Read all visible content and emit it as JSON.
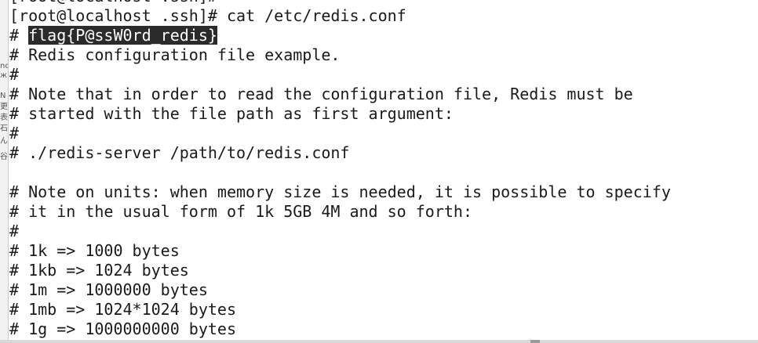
{
  "terminal": {
    "left_strip_glyphs": [
      "nc",
      "ж",
      "N",
      "更",
      "表",
      "石",
      "ん",
      "谷"
    ],
    "lines": [
      {
        "prefix": "[root@localhost .ssh]#",
        "highlight": "",
        "suffix": ""
      },
      {
        "prefix": "[root@localhost .ssh]# cat /etc/redis.conf",
        "highlight": "",
        "suffix": ""
      },
      {
        "prefix": "# ",
        "highlight": "flag{P@ssW0rd_redis}",
        "suffix": ""
      },
      {
        "prefix": "# Redis configuration file example.",
        "highlight": "",
        "suffix": ""
      },
      {
        "prefix": "#",
        "highlight": "",
        "suffix": ""
      },
      {
        "prefix": "# Note that in order to read the configuration file, Redis must be",
        "highlight": "",
        "suffix": ""
      },
      {
        "prefix": "# started with the file path as first argument:",
        "highlight": "",
        "suffix": ""
      },
      {
        "prefix": "#",
        "highlight": "",
        "suffix": ""
      },
      {
        "prefix": "# ./redis-server /path/to/redis.conf",
        "highlight": "",
        "suffix": ""
      },
      {
        "prefix": "",
        "highlight": "",
        "suffix": ""
      },
      {
        "prefix": "# Note on units: when memory size is needed, it is possible to specify",
        "highlight": "",
        "suffix": ""
      },
      {
        "prefix": "# it in the usual form of 1k 5GB 4M and so forth:",
        "highlight": "",
        "suffix": ""
      },
      {
        "prefix": "#",
        "highlight": "",
        "suffix": ""
      },
      {
        "prefix": "# 1k => 1000 bytes",
        "highlight": "",
        "suffix": ""
      },
      {
        "prefix": "# 1kb => 1024 bytes",
        "highlight": "",
        "suffix": ""
      },
      {
        "prefix": "# 1m => 1000000 bytes",
        "highlight": "",
        "suffix": ""
      },
      {
        "prefix": "# 1mb => 1024*1024 bytes",
        "highlight": "",
        "suffix": ""
      },
      {
        "prefix": "# 1g => 1000000000 bytes",
        "highlight": "",
        "suffix": ""
      }
    ]
  }
}
